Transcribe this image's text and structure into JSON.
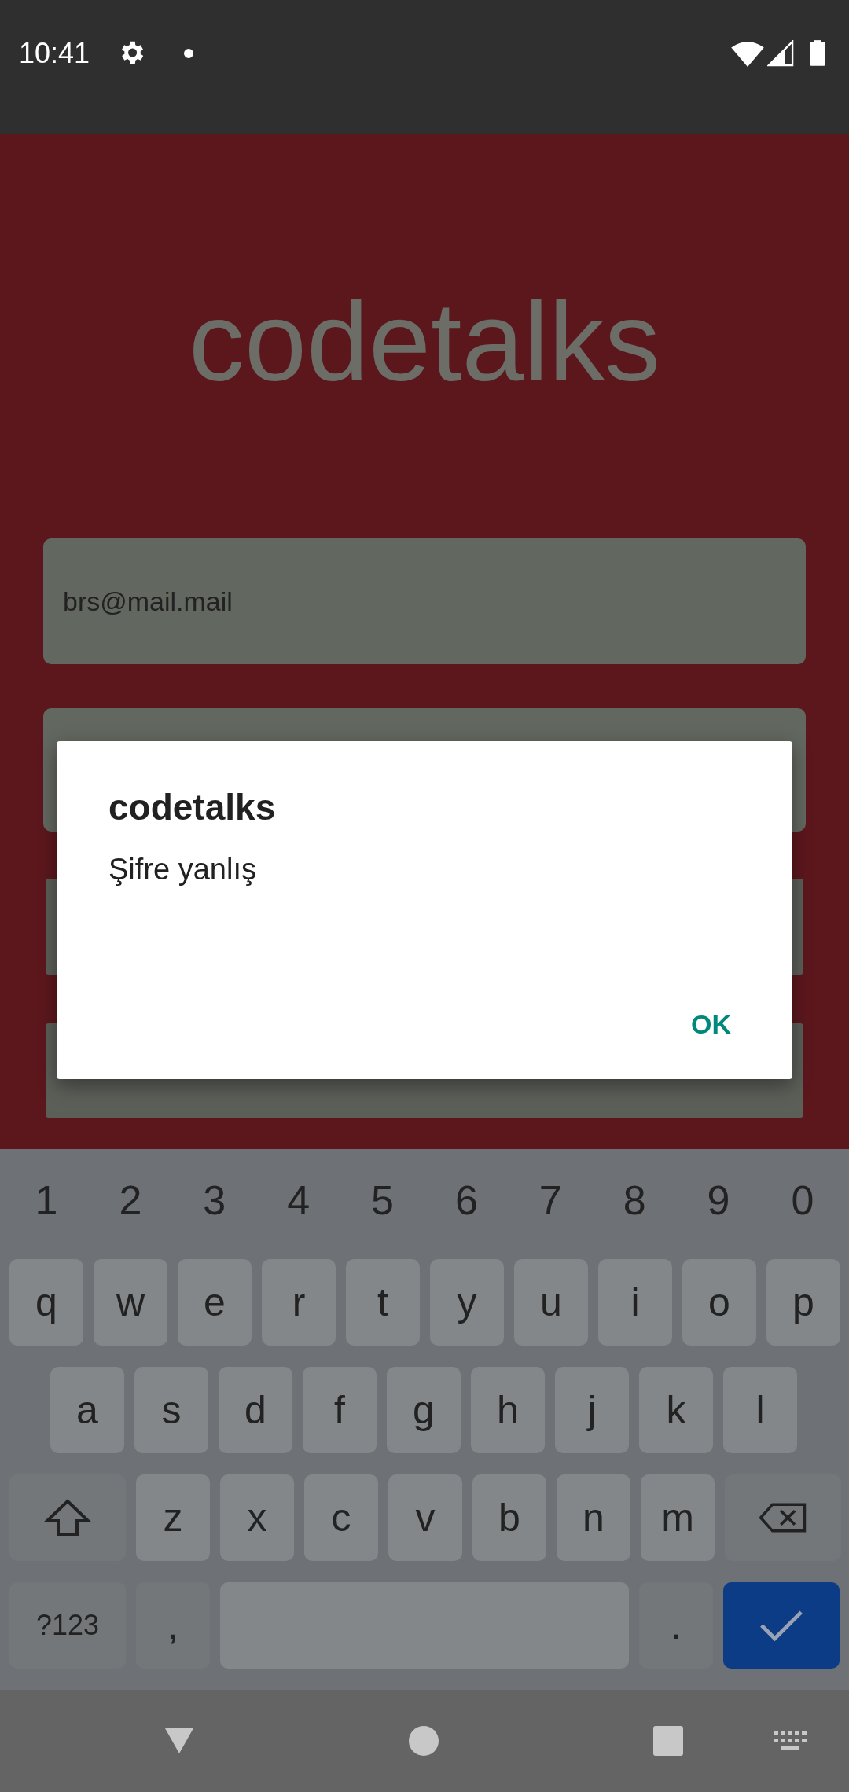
{
  "status_bar": {
    "time": "10:41"
  },
  "app": {
    "title": "codetalks",
    "email_field": {
      "value": "brs@mail.mail"
    }
  },
  "dialog": {
    "title": "codetalks",
    "message": "Şifre yanlış",
    "button": "OK"
  },
  "keyboard": {
    "number_row": [
      "1",
      "2",
      "3",
      "4",
      "5",
      "6",
      "7",
      "8",
      "9",
      "0"
    ],
    "letter_rows": [
      [
        "q",
        "w",
        "e",
        "r",
        "t",
        "y",
        "u",
        "i",
        "o",
        "p"
      ],
      [
        "a",
        "s",
        "d",
        "f",
        "g",
        "h",
        "j",
        "k",
        "l"
      ],
      [
        "z",
        "x",
        "c",
        "v",
        "b",
        "n",
        "m"
      ]
    ],
    "bottom_row": [
      {
        "kind": "symbols",
        "label": "?123"
      },
      {
        "kind": "char",
        "label": ","
      },
      {
        "kind": "space"
      },
      {
        "kind": "char",
        "label": "."
      },
      {
        "kind": "enter"
      }
    ]
  }
}
